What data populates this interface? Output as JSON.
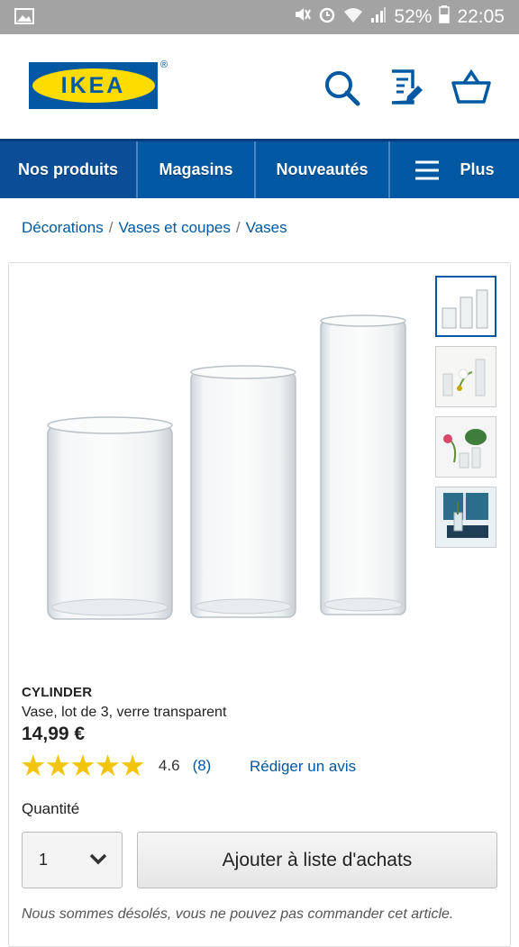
{
  "status_bar": {
    "battery": "52%",
    "time": "22:05"
  },
  "header": {
    "logo_text": "IKEA",
    "registered": "®"
  },
  "nav": {
    "items": [
      "Nos produits",
      "Magasins",
      "Nouveautés",
      "Plus"
    ]
  },
  "breadcrumb": {
    "items": [
      "Décorations",
      "Vases et coupes",
      "Vases"
    ],
    "separator": "/"
  },
  "product": {
    "name": "CYLINDER",
    "description": "Vase, lot de 3, verre transparent",
    "price": "14,99 €",
    "rating": {
      "stars": "★★★★★",
      "value": "4.6",
      "count": "(8)"
    },
    "write_review": "Rédiger un avis",
    "quantity_label": "Quantité",
    "quantity_value": "1",
    "add_to_list": "Ajouter à liste d'achats",
    "unavailable_note": "Nous sommes désolés, vous ne pouvez pas commander cet article."
  },
  "colors": {
    "brand_blue": "#0058a3",
    "brand_yellow": "#ffdb00",
    "star": "#f2c40d"
  }
}
